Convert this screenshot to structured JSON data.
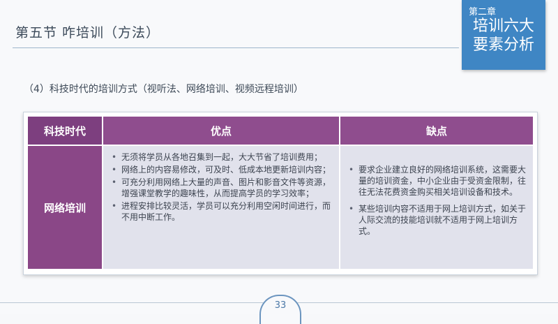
{
  "header": {
    "title": "第五节 咋培训（方法）",
    "chapter_number": "第二章",
    "chapter_title_line1": "培训六大",
    "chapter_title_line2": "要素分析"
  },
  "subtitle": "（4）科技时代的培训方式（视听法、网络培训、视频远程培训）",
  "table": {
    "headers": [
      "科技时代",
      "优点",
      "缺点"
    ],
    "row_label": "网络培训",
    "advantages": [
      "无须将学员从各地召集到一起，大大节省了培训费用；",
      "网络上的内容易修改，可及时、低成本地更新培训内容；",
      "可充分利用网络上大量的声音、图片和影音文件等资源，增强课堂教学的趣味性，从而提高学员的学习效率；",
      "进程安排比较灵活，学员可以充分利用空闲时间进行，而不用中断工作。"
    ],
    "disadvantages": [
      "要求企业建立良好的网络培训系统，这需要大量的培训资金，中小企业由于受资金限制，往往无法花费资金购买相关培训设备和技术。",
      "某些培训内容不适用于网上培训方式，如关于人际交流的技能培训就不适用于网上培训方式。"
    ]
  },
  "footer": {
    "page_number": "33"
  }
}
